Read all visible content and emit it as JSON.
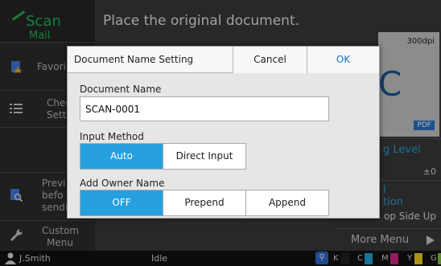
{
  "app": {
    "name": "Scan",
    "sub": "Mail"
  },
  "main_title": "Place the original document.",
  "sidebar": {
    "items": [
      {
        "label": "Favori"
      },
      {
        "label_line1": "Chec",
        "label_line2": "Setti"
      },
      {
        "label_line1": "Previ",
        "label_line2": "befo",
        "label_line3": "sendi"
      },
      {
        "label_line1": "Custom",
        "label_line2": "Menu"
      }
    ]
  },
  "preview": {
    "dpi": "300dpi",
    "glyph": "C",
    "format": "PDF"
  },
  "right_settings": [
    {
      "a": "g Level",
      "b": "±0"
    },
    {
      "a": "l",
      "a2": "tion",
      "b": "op Side Up"
    }
  ],
  "more_menu": "More Menu",
  "status": {
    "user": "J.Smith",
    "state": "Idle",
    "toner": [
      "K",
      "C",
      "M",
      "Y",
      "G"
    ]
  },
  "colors": {
    "accent_green": "#20b35a",
    "selected_blue": "#27a0e0",
    "ok_blue": "#1b73c8",
    "toner_k": "#222222",
    "toner_c": "#1fa6dc",
    "toner_m": "#d9248a",
    "toner_y": "#f2d31a",
    "toner_g": "#8cc63f"
  },
  "dialog": {
    "title": "Document Name Setting",
    "cancel": "Cancel",
    "ok": "OK",
    "doc_name_label": "Document Name",
    "doc_name_value": "SCAN-0001",
    "input_method_label": "Input Method",
    "input_method_options": [
      "Auto",
      "Direct Input"
    ],
    "input_method_selected": "Auto",
    "owner_label": "Add Owner Name",
    "owner_options": [
      "OFF",
      "Prepend",
      "Append"
    ],
    "owner_selected": "OFF"
  }
}
